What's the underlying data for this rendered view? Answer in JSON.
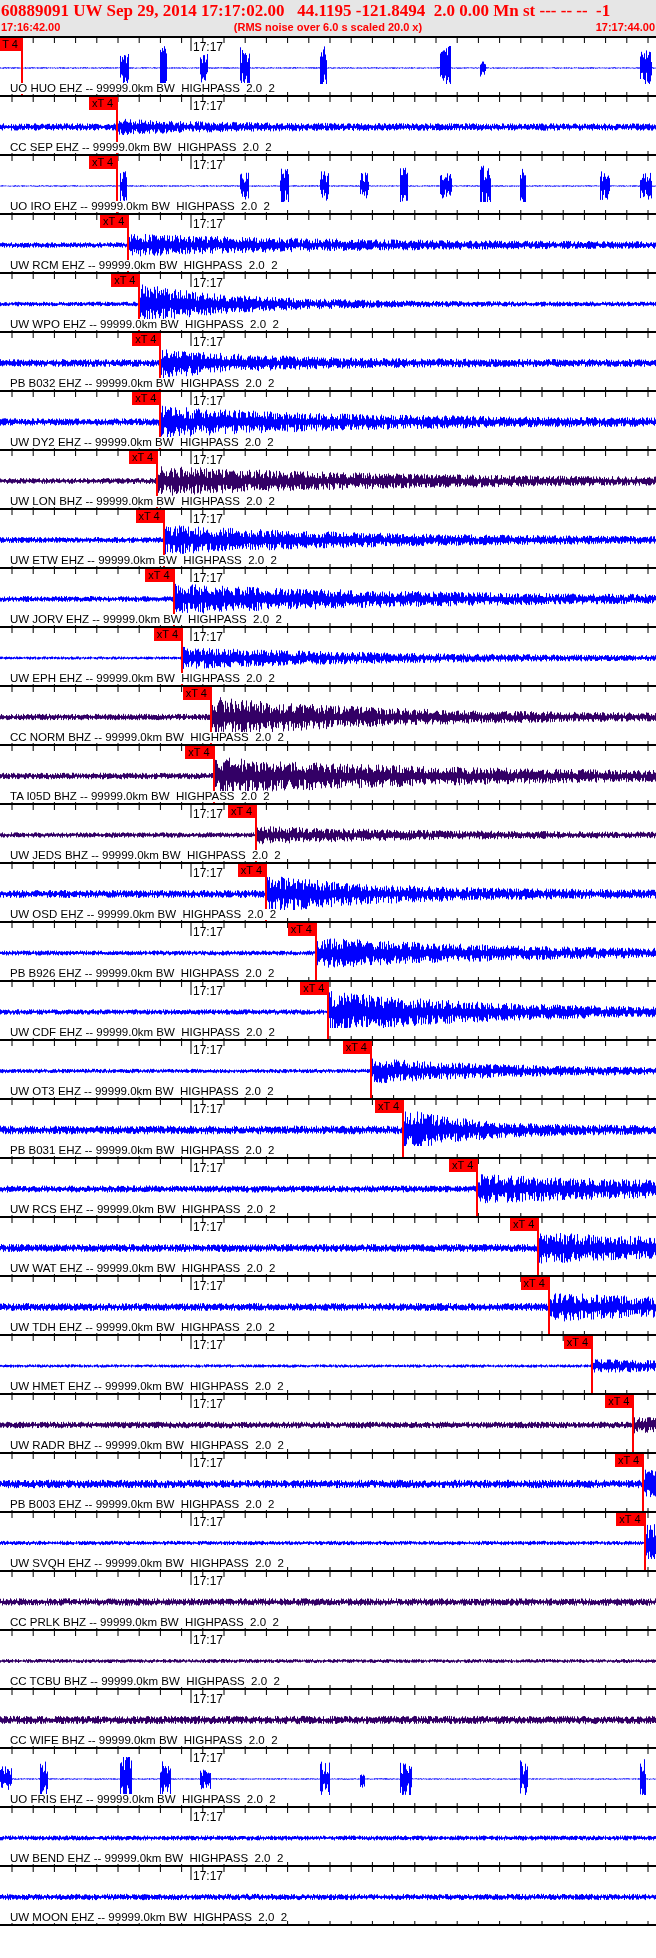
{
  "header": {
    "title": "60889091 UW Sep 29, 2014 17:17:02.00   44.1195 -121.8494  2.0 0.00 Mn st --- -- --  -1",
    "start_time": "17:16:42.00",
    "note": "(RMS noise over 6.0 s scaled 20.0 x)",
    "end_time": "17:17:44.00"
  },
  "traces": [
    {
      "label": "UO HUO EHZ -- 99999.0km BW  HIGHPASS  2.0  2",
      "time_mark": "17:17",
      "kind": "bursts",
      "color": "#0000ff",
      "pick": {
        "label": "T 4",
        "level": 0.032
      }
    },
    {
      "label": "CC SEP EHZ -- 99999.0km BW  HIGHPASS  2.0  2",
      "time_mark": "17:17",
      "kind": "noise",
      "color": "#0000ff",
      "pick": {
        "label": "xT 4",
        "level": 0.177
      }
    },
    {
      "label": "UO IRO EHZ -- 99999.0km BW  HIGHPASS  2.0  2",
      "time_mark": "17:17",
      "kind": "bursts",
      "color": "#0000ff",
      "pick": {
        "label": "xT 4",
        "level": 0.177
      }
    },
    {
      "label": "UW RCM EHZ -- 99999.0km BW  HIGHPASS  2.0  2",
      "time_mark": "17:17",
      "kind": "noise",
      "color": "#0000ff",
      "pick": {
        "label": "xT 4",
        "level": 0.194
      }
    },
    {
      "label": "UW WPO EHZ -- 99999.0km BW  HIGHPASS  2.0  2",
      "time_mark": "17:17",
      "kind": "noise",
      "color": "#0000ff",
      "pick": {
        "label": "xT 4",
        "level": 0.211
      }
    },
    {
      "label": "PB B032 EHZ -- 99999.0km BW  HIGHPASS  2.0  2",
      "time_mark": "17:17",
      "kind": "noise",
      "color": "#0000ff",
      "pick": {
        "label": "xT 4",
        "level": 0.243
      }
    },
    {
      "label": "UW DY2 EHZ -- 99999.0km BW  HIGHPASS  2.0  2",
      "time_mark": "17:17",
      "kind": "noise",
      "color": "#0000ff",
      "pick": {
        "label": "xT 4",
        "level": 0.243
      }
    },
    {
      "label": "UW LON BHZ -- 99999.0km BW  HIGHPASS  2.0  2",
      "time_mark": "17:17",
      "kind": "noise",
      "color": "#330066",
      "pick": {
        "label": "xT 4",
        "level": 0.238
      }
    },
    {
      "label": "UW ETW EHZ -- 99999.0km BW  HIGHPASS  2.0  2",
      "time_mark": "17:17",
      "kind": "noise",
      "color": "#0000ff",
      "pick": {
        "label": "xT 4",
        "level": 0.248
      }
    },
    {
      "label": "UW JORV EHZ -- 99999.0km BW  HIGHPASS  2.0  2",
      "time_mark": "17:17",
      "kind": "noise",
      "color": "#0000ff",
      "pick": {
        "label": "xT 4",
        "level": 0.263
      }
    },
    {
      "label": "UW EPH EHZ -- 99999.0km BW  HIGHPASS  2.0  2",
      "time_mark": "17:17",
      "kind": "noise",
      "color": "#0000ff",
      "pick": {
        "label": "xT 4",
        "level": 0.276
      }
    },
    {
      "label": "CC NORM BHZ -- 99999.0km BW  HIGHPASS  2.0  2",
      "kind": "noise",
      "color": "#330066",
      "pick": {
        "label": "xT 4",
        "level": 0.32
      }
    },
    {
      "label": "TA I05D BHZ -- 99999.0km BW  HIGHPASS  2.0  2",
      "kind": "noise",
      "color": "#330066",
      "pick": {
        "label": "xT 4",
        "level": 0.324
      }
    },
    {
      "label": "UW JEDS BHZ -- 99999.0km BW  HIGHPASS  2.0  2",
      "time_mark": "17:17",
      "kind": "noise",
      "color": "#330066",
      "pick": {
        "label": "xT 4",
        "level": 0.389
      }
    },
    {
      "label": "UW OSD EHZ -- 99999.0km BW  HIGHPASS  2.0  2",
      "time_mark": "17:17",
      "kind": "noise",
      "color": "#0000ff",
      "pick": {
        "label": "xT 4",
        "level": 0.404
      }
    },
    {
      "label": "PB B926 EHZ -- 99999.0km BW  HIGHPASS  2.0  2",
      "time_mark": "17:17",
      "kind": "noise",
      "color": "#0000ff",
      "pick": {
        "label": "xT 4",
        "level": 0.48
      }
    },
    {
      "label": "UW CDF EHZ -- 99999.0km BW  HIGHPASS  2.0  2",
      "time_mark": "17:17",
      "kind": "noise",
      "color": "#0000ff",
      "pick": {
        "label": "xT 4",
        "level": 0.499
      }
    },
    {
      "label": "UW OT3 EHZ -- 99999.0km BW  HIGHPASS  2.0  2",
      "time_mark": "17:17",
      "kind": "noise",
      "color": "#0000ff",
      "pick": {
        "label": "xT 4",
        "level": 0.564
      }
    },
    {
      "label": "PB B031 EHZ -- 99999.0km BW  HIGHPASS  2.0  2",
      "time_mark": "17:17",
      "kind": "noise",
      "color": "#0000ff",
      "pick": {
        "label": "xT 4",
        "level": 0.613
      }
    },
    {
      "label": "UW RCS EHZ -- 99999.0km BW  HIGHPASS  2.0  2",
      "time_mark": "17:17",
      "kind": "noise",
      "color": "#0000ff",
      "pick": {
        "label": "xT 4",
        "level": 0.726
      }
    },
    {
      "label": "UW WAT EHZ -- 99999.0km BW  HIGHPASS  2.0  2",
      "time_mark": "17:17",
      "kind": "noise",
      "color": "#0000ff",
      "pick": {
        "label": "xT 4",
        "level": 0.819
      }
    },
    {
      "label": "UW TDH EHZ -- 99999.0km BW  HIGHPASS  2.0  2",
      "time_mark": "17:17",
      "kind": "noise",
      "color": "#0000ff",
      "pick": {
        "label": "xT 4",
        "level": 0.835
      }
    },
    {
      "label": "UW HMET EHZ -- 99999.0km BW  HIGHPASS  2.0  2",
      "time_mark": "17:17",
      "kind": "noise",
      "color": "#0000ff",
      "pick": {
        "label": "xT 4",
        "level": 0.901
      }
    },
    {
      "label": "UW RADR BHZ -- 99999.0km BW  HIGHPASS  2.0  2",
      "time_mark": "17:17",
      "kind": "noise",
      "color": "#330066",
      "pick": {
        "label": "xT 4",
        "level": 0.964
      }
    },
    {
      "label": "PB B003 EHZ -- 99999.0km BW  HIGHPASS  2.0  2",
      "time_mark": "17:17",
      "kind": "noise",
      "color": "#0000ff",
      "pick": {
        "label": "xT 4",
        "level": 0.979
      }
    },
    {
      "label": "UW SVQH EHZ -- 99999.0km BW  HIGHPASS  2.0  2",
      "time_mark": "17:17",
      "kind": "noise",
      "color": "#0000ff",
      "pick": {
        "label": "xT 4",
        "level": 0.981
      }
    },
    {
      "label": "CC PRLK BHZ -- 99999.0km BW  HIGHPASS  2.0  2",
      "time_mark": "17:17",
      "kind": "noise",
      "color": "#330066"
    },
    {
      "label": "CC TCBU BHZ -- 99999.0km BW  HIGHPASS  2.0  2",
      "time_mark": "17:17",
      "kind": "noise",
      "color": "#330066"
    },
    {
      "label": "CC WIFE BHZ -- 99999.0km BW  HIGHPASS  2.0  2",
      "time_mark": "17:17",
      "kind": "noise",
      "color": "#330066"
    },
    {
      "label": "UO FRIS EHZ -- 99999.0km BW  HIGHPASS  2.0  2",
      "time_mark": "17:17",
      "kind": "bursts",
      "color": "#0000ff"
    },
    {
      "label": "UW BEND EHZ -- 99999.0km BW  HIGHPASS  2.0  2",
      "time_mark": "17:17",
      "kind": "noise",
      "color": "#0000ff"
    },
    {
      "label": "UW MOON EHZ -- 99999.0km BW  HIGHPASS  2.0  2",
      "time_mark": "17:17",
      "kind": "noise",
      "color": "#0000ff"
    }
  ]
}
